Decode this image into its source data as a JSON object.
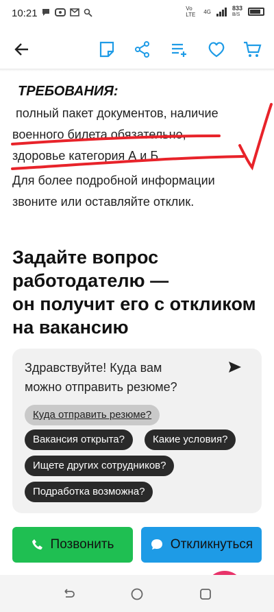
{
  "status_bar": {
    "time": "10:21",
    "network_label": "Vo LTE",
    "net_gen": "4G",
    "speed_value": "833",
    "speed_unit": "B/S"
  },
  "app_bar": {
    "icons": [
      "back-arrow-icon",
      "note-icon",
      "share-icon",
      "compare-list-icon",
      "heart-icon",
      "cart-icon"
    ],
    "accent": "#1e9be6"
  },
  "requirements": {
    "title": "ТРЕБОВАНИЯ:",
    "line1": " полный пакет документов, наличие",
    "line2": "военного билета обязательно,",
    "line3": "здоровье категория А и Б"
  },
  "more_info": {
    "line1": "Для более подробной информации",
    "line2": "звоните или оставляйте отклик."
  },
  "ask_section": {
    "line1": "Задайте вопрос",
    "line2": "работодателю —",
    "line3": "он получит его с откликом",
    "line4": "на вакансию"
  },
  "question_card": {
    "message_line1": "Здравствуйте! Куда вам",
    "message_line2": "можно отправить резюме?",
    "chips": [
      "Куда отправить резюме?",
      "Вакансия открыта?",
      "Какие условия?",
      "Ищете других сотрудников?",
      "Подработка возможна?"
    ]
  },
  "actions": {
    "call_label": "Позвонить",
    "reply_label": "Откликнуться",
    "call_color": "#1fbf52",
    "reply_color": "#1e9be6"
  },
  "annotation_color": "#e8232a"
}
